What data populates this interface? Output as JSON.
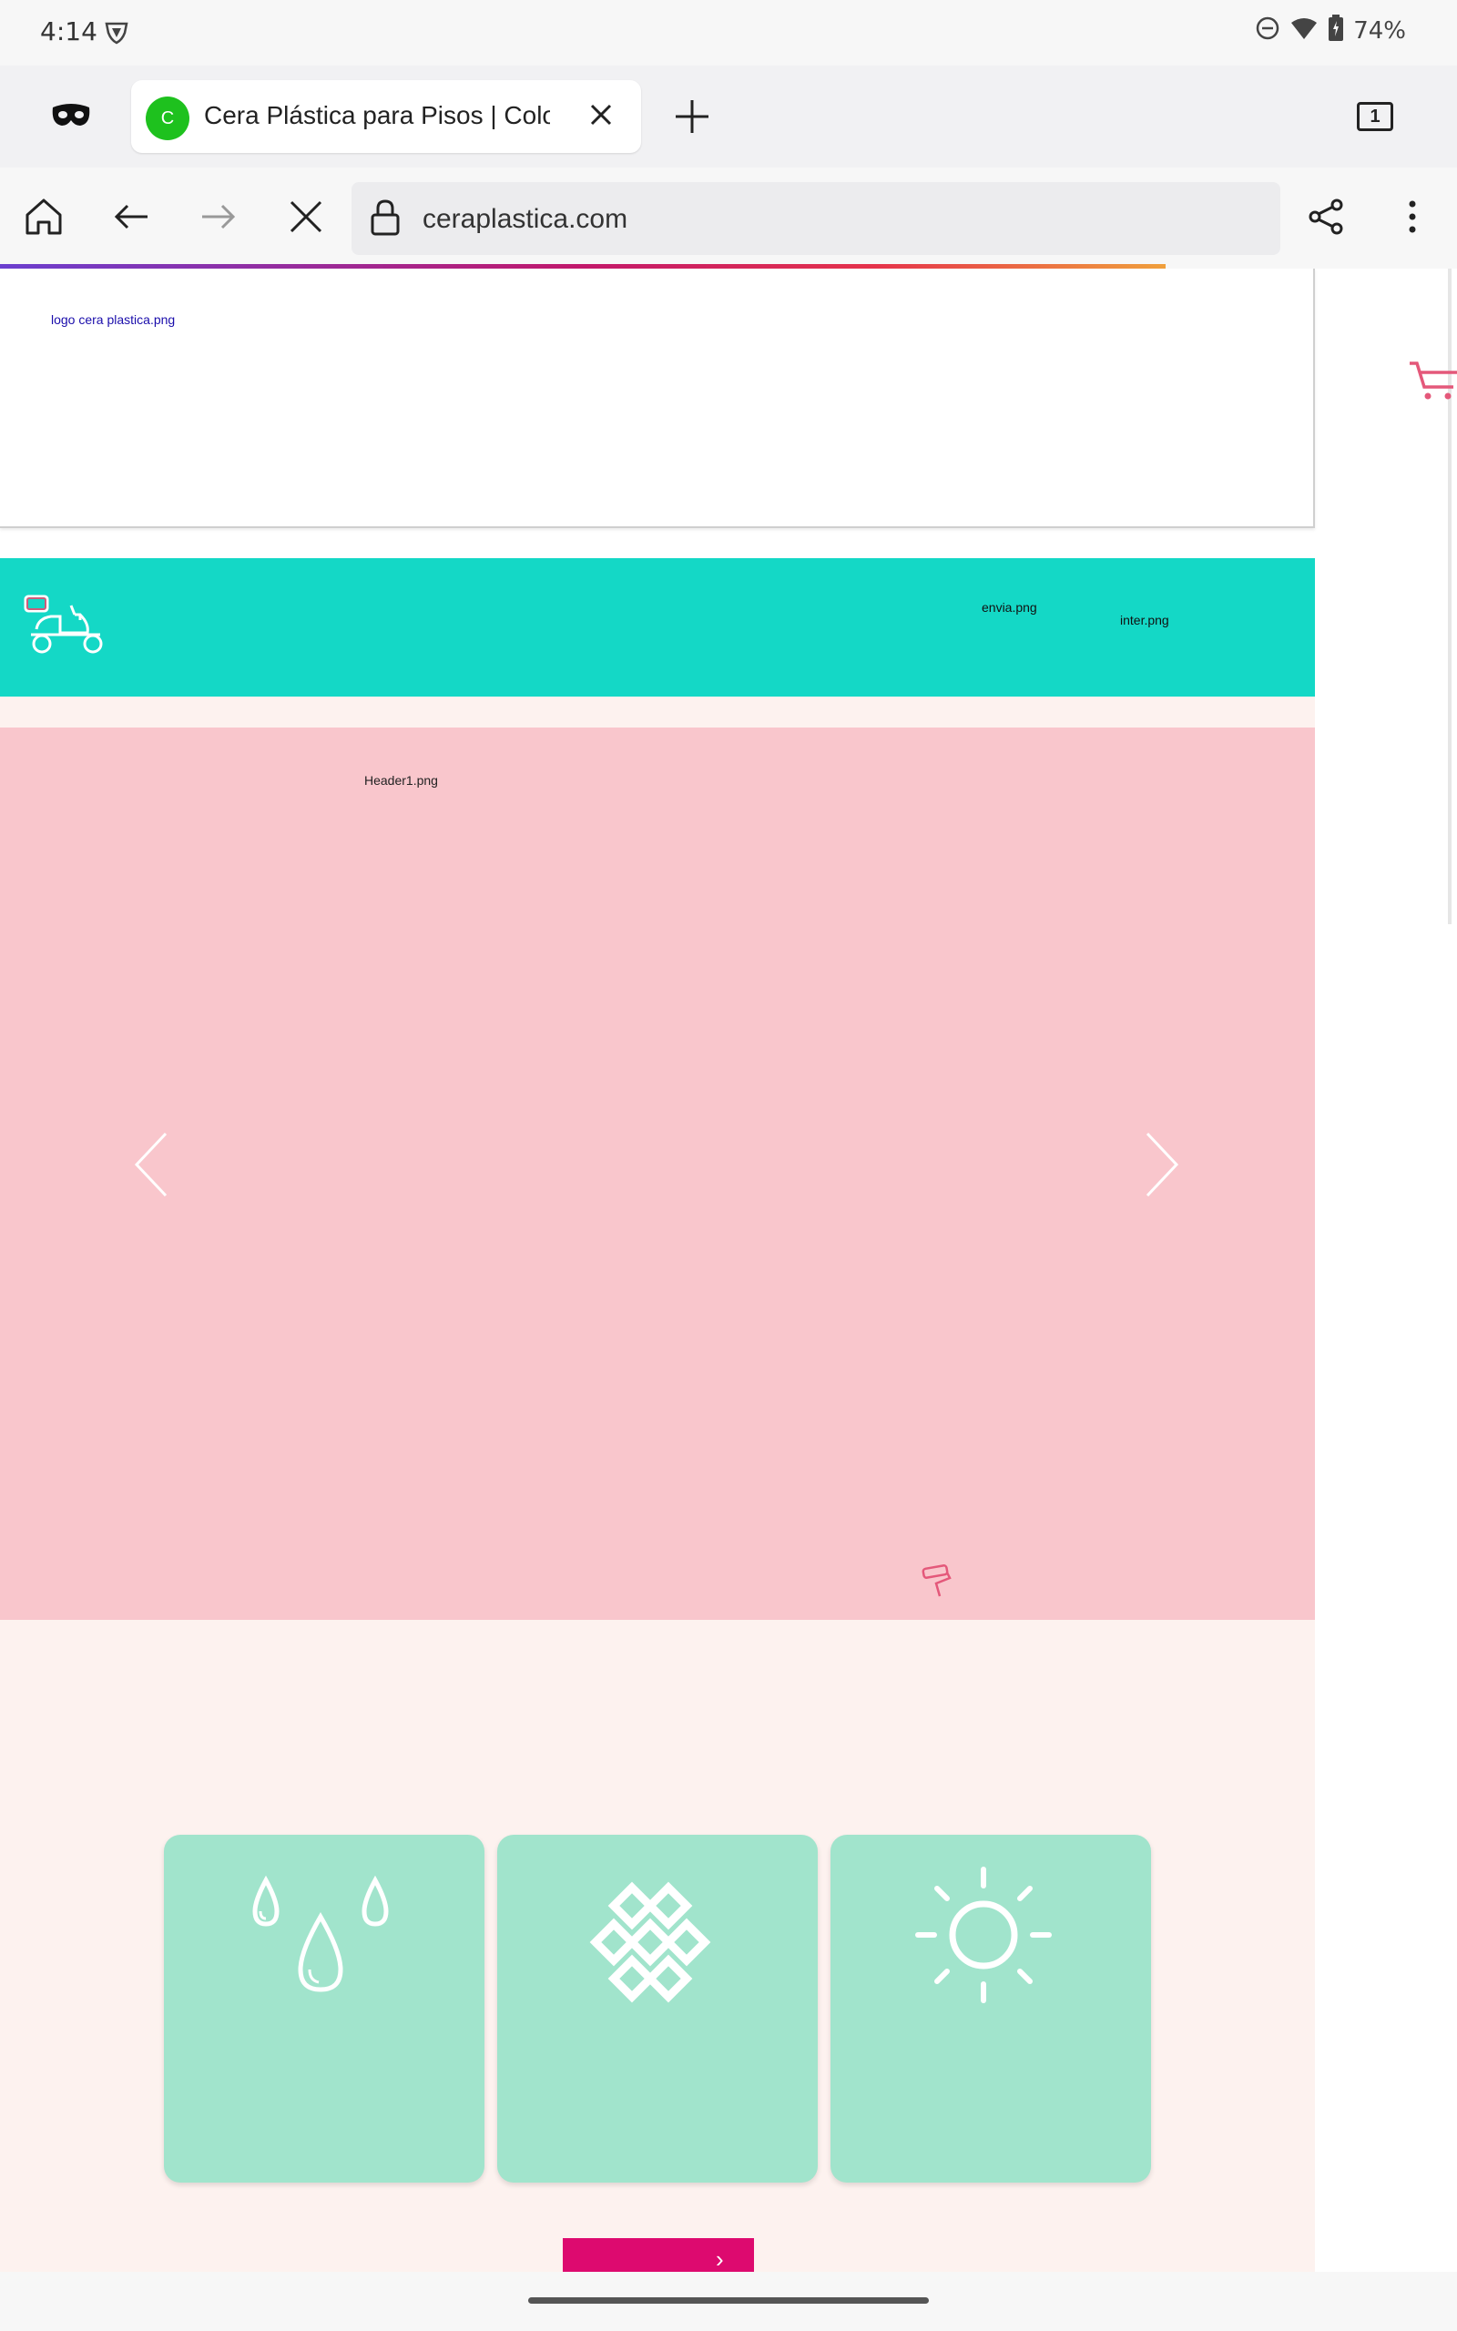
{
  "status_bar": {
    "time": "4:14",
    "battery": "74%",
    "icons": [
      "shield-icon",
      "do-not-disturb-icon",
      "wifi-icon",
      "battery-icon"
    ]
  },
  "browser": {
    "tab": {
      "favicon_letter": "C",
      "title": "Cera Plástica para Pisos | Colores"
    },
    "tab_count": "1",
    "url": "ceraplastica.com",
    "colors": {
      "favicon": "#1ec11e",
      "progress_start": "#6b3fcf",
      "progress_end": "#f0a03c"
    }
  },
  "site": {
    "header": {
      "logo_alt": "logo cera plastica.png"
    },
    "delivery_bar": {
      "envia_alt": "envia.png",
      "inter_alt": "inter.png",
      "color": "#14d8c6"
    },
    "hero": {
      "image_alt": "Header1.png",
      "color": "#f9c6cc"
    },
    "features": {
      "cards": [
        {
          "icon": "water-drops-icon"
        },
        {
          "icon": "tiles-icon"
        },
        {
          "icon": "sun-icon"
        }
      ],
      "card_color": "#a1e4cc"
    },
    "cta": {
      "arrow": "›",
      "color": "#dd0a6f"
    }
  }
}
